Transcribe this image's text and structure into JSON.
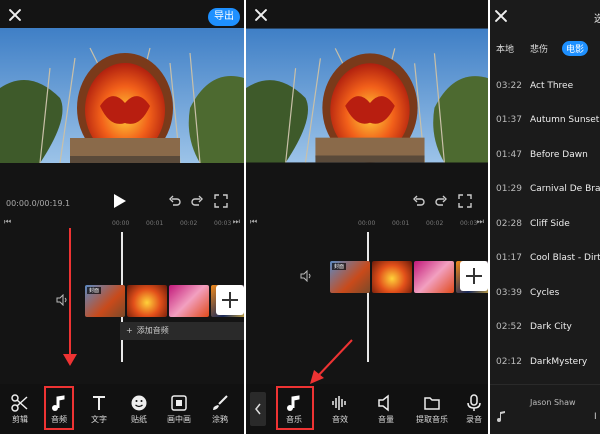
{
  "panel1": {
    "export_label": "导出",
    "time": "00:00.0/00:19.1",
    "ruler": [
      "00:00",
      "00:01",
      "00:02",
      "00:03"
    ],
    "cover_label": "封面",
    "add_audio_label": "添加音频",
    "toolbar": [
      {
        "label": "剪辑",
        "icon": "scissors-icon"
      },
      {
        "label": "音频",
        "icon": "music-note-icon"
      },
      {
        "label": "文字",
        "icon": "text-icon"
      },
      {
        "label": "贴纸",
        "icon": "sticker-icon"
      },
      {
        "label": "画中画",
        "icon": "picture-in-picture-icon"
      },
      {
        "label": "涂鸦",
        "icon": "brush-icon"
      }
    ]
  },
  "panel2": {
    "ruler": [
      "00:00",
      "00:01",
      "00:02",
      "00:03"
    ],
    "cover_label": "封面",
    "toolbar": [
      {
        "label": "音乐",
        "icon": "music-note-icon"
      },
      {
        "label": "音效",
        "icon": "sound-wave-icon"
      },
      {
        "label": "音量",
        "icon": "volume-icon"
      },
      {
        "label": "提取音乐",
        "icon": "folder-icon"
      },
      {
        "label": "录音",
        "icon": "microphone-icon"
      }
    ]
  },
  "panel3": {
    "top_right": "选",
    "tabs": [
      "本地",
      "悲伤",
      "电影"
    ],
    "active_tab": "电影",
    "songs": [
      {
        "duration": "03:22",
        "title": "Act Three"
      },
      {
        "duration": "01:37",
        "title": "Autumn Sunset"
      },
      {
        "duration": "01:47",
        "title": "Before Dawn"
      },
      {
        "duration": "01:29",
        "title": "Carnival De Bravo"
      },
      {
        "duration": "02:28",
        "title": "Cliff Side"
      },
      {
        "duration": "01:17",
        "title": "Cool Blast - Dirty"
      },
      {
        "duration": "03:39",
        "title": "Cycles"
      },
      {
        "duration": "02:52",
        "title": "Dark City"
      },
      {
        "duration": "02:12",
        "title": "DarkMystery"
      }
    ],
    "artist": "Jason Shaw",
    "artist_suffix": "I"
  },
  "colors": {
    "accent": "#1e90ff",
    "highlight": "#e33333",
    "background": "#141414"
  }
}
